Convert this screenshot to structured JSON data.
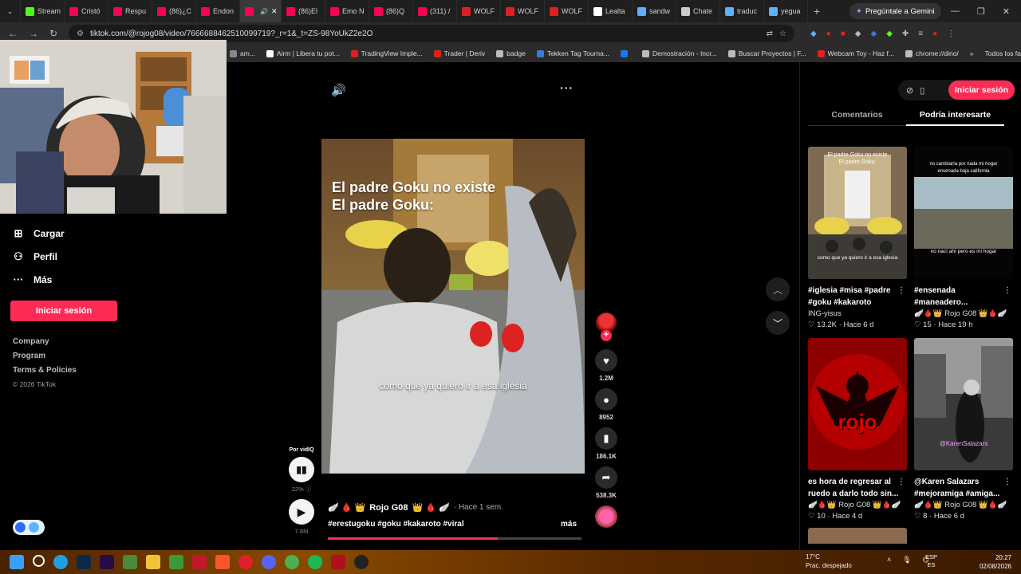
{
  "browser": {
    "tabs": [
      {
        "label": "Stream",
        "color": "#53fc18"
      },
      {
        "label": "Cristó",
        "color": "#ff0050"
      },
      {
        "label": "Respu",
        "color": "#ff0050"
      },
      {
        "label": "(86)¿C",
        "color": "#ff0050"
      },
      {
        "label": "Endon",
        "color": "#ff0050"
      },
      {
        "label": "",
        "color": "#ff0050"
      },
      {
        "label": "(86)El",
        "color": "#ff0050"
      },
      {
        "label": "Emo N",
        "color": "#ff0050"
      },
      {
        "label": "(86)Q",
        "color": "#ff0050"
      },
      {
        "label": "(311) /",
        "color": "#ff0050"
      },
      {
        "label": "WOLF",
        "color": "#e02020"
      },
      {
        "label": "WOLF",
        "color": "#e02020"
      },
      {
        "label": "WOLF",
        "color": "#e02020"
      },
      {
        "label": "Lealta",
        "color": "#ffffff"
      },
      {
        "label": "sandw",
        "color": "#5fb0ff"
      },
      {
        "label": "Chate",
        "color": "#cccccc"
      },
      {
        "label": "traduc",
        "color": "#5fb0ff"
      },
      {
        "label": "yegua",
        "color": "#5fb0ff"
      }
    ],
    "new_tab": "+",
    "gemini_label": "Pregúntale a Gemini",
    "url": "tiktok.com/@rojog08/video/7666688462510099719?_r=1&_t=ZS-98YoUkZ2e2O",
    "window_controls": [
      "—",
      "❐",
      "✕"
    ],
    "bookmarks": [
      {
        "label": "am...",
        "color": "#888888"
      },
      {
        "label": "Airm | Libera tu pot...",
        "color": "#ffffff"
      },
      {
        "label": "TradingView Imple...",
        "color": "#e02020"
      },
      {
        "label": "Trader | Deriv",
        "color": "#e02020"
      },
      {
        "label": "badge",
        "color": "#bbbbbb"
      },
      {
        "label": "Tekken Tag Tourna...",
        "color": "#3b7bd8"
      },
      {
        "label": "",
        "color": "#1877f2"
      },
      {
        "label": "Demostración - Incr...",
        "color": "#bbbbbb"
      },
      {
        "label": "Buscar Proyectos | F...",
        "color": "#bbbbbb"
      },
      {
        "label": "Webcam Toy - Haz f...",
        "color": "#e02020"
      },
      {
        "label": "chrome://dino/",
        "color": "#bbbbbb"
      }
    ],
    "bookmarks_more": "»",
    "all_bookmarks": "Todos los favoritos"
  },
  "sidebar": {
    "items": [
      {
        "label": "Cargar",
        "icon": "plus-square-icon"
      },
      {
        "label": "Perfil",
        "icon": "person-icon"
      },
      {
        "label": "Más",
        "icon": "more-icon"
      }
    ],
    "login_label": "Iniciar sesión",
    "footer_links": [
      "Company",
      "Program",
      "Terms & Policies"
    ],
    "copyright": "© 2026 TikTok"
  },
  "video": {
    "overlay_line1": "El padre Goku no existe",
    "overlay_line2": "El padre Goku:",
    "caption": "como que ya quiero ir a esa iglesia",
    "author": "Rojo G08",
    "ago": "Hace 1 sem.",
    "hashtags": "#erestugoku #goku #kakaroto #viral",
    "more_label": "más",
    "progress": 0.67,
    "likes": "1.2M",
    "comments": "8952",
    "saves": "186.1K",
    "shares": "538.3K"
  },
  "vidiq": {
    "label": "Por vidIQ",
    "percent": "22%",
    "views": "7.8M"
  },
  "right_panel": {
    "login_label": "Iniciar sesión",
    "tabs": [
      "Comentarios",
      "Podría interesarte"
    ],
    "active_tab": 1,
    "cards": [
      {
        "thumb_text": "El padre Goku no existe\nEl padre Goku:",
        "thumb_caption": "como que ya quiero ir a esa iglesia",
        "title": "#iglesia #misa #padre #goku #kakaroto",
        "author": "ING-yisus",
        "likes": "13.2K",
        "ago": "Hace 6 d"
      },
      {
        "thumb_text": "no cambiaría por nada mi hogar\nensenada baja california",
        "thumb_caption": "no nací ahí pero es mi hogar",
        "title": "#ensenada #maneadero...",
        "author": "Rojo G08",
        "likes": "15",
        "ago": "Hace 19 h"
      },
      {
        "thumb_text": "rojo",
        "thumb_caption": "",
        "title": "es hora de regresar al ruedo a darlo todo sin...",
        "author": "Rojo G08",
        "likes": "10",
        "ago": "Hace 4 d"
      },
      {
        "thumb_text": "@KarenSalazars",
        "thumb_caption": "",
        "title": "@Karen Salazars #mejoramiga #amiga...",
        "author": "Rojo G08",
        "likes": "8",
        "ago": "Hace 6 d"
      }
    ]
  },
  "taskbar": {
    "weather_temp": "17°C",
    "weather_desc": "Prac. despejado",
    "lang_top": "ESP",
    "lang_bottom": "ES",
    "time": "20:27",
    "date": "02/08/2026"
  }
}
